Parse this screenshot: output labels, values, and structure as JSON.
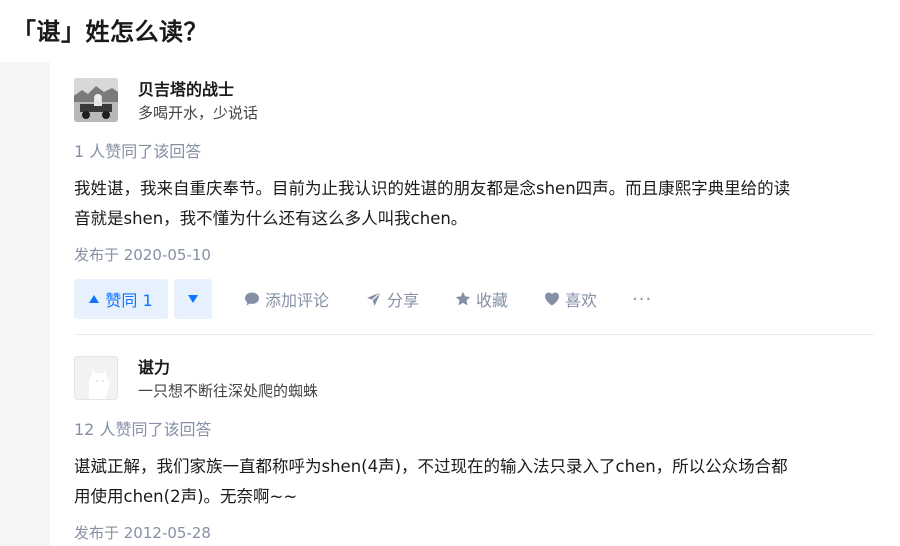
{
  "question": {
    "title": "「谌」姓怎么读？"
  },
  "answers": [
    {
      "author_name": "贝吉塔的战士",
      "author_bio": "多喝开水，少说话",
      "votes_text": "1 人赞同了该回答",
      "content_line1": "我姓谌，我来自重庆奉节。目前为止我认识的姓谌的朋友都是念shen四声。而且康熙字典里给的读",
      "content_line2": "音就是shen，我不懂为什么还有这么多人叫我chen。",
      "date": "发布于 2020-05-10",
      "upvote_label": "赞同 1",
      "actions": {
        "comment": "添加评论",
        "share": "分享",
        "collect": "收藏",
        "like": "喜欢",
        "more": "···"
      },
      "avatar": "photo-avatar"
    },
    {
      "author_name": "谌力",
      "author_bio": "一只想不断往深处爬的蜘蛛",
      "votes_text": "12 人赞同了该回答",
      "content_line1": "谌斌正解，我们家族一直都称呼为shen(4声)，不过现在的输入法只录入了chen，所以公众场合都",
      "content_line2": "用使用chen(2声)。无奈啊~~",
      "date": "发布于 2012-05-28",
      "avatar": "default-avatar"
    }
  ],
  "colors": {
    "accent": "#0f74ff",
    "accent_bg": "#e7f0fd",
    "muted": "#8590a6",
    "page_bg": "#f6f6f6"
  }
}
